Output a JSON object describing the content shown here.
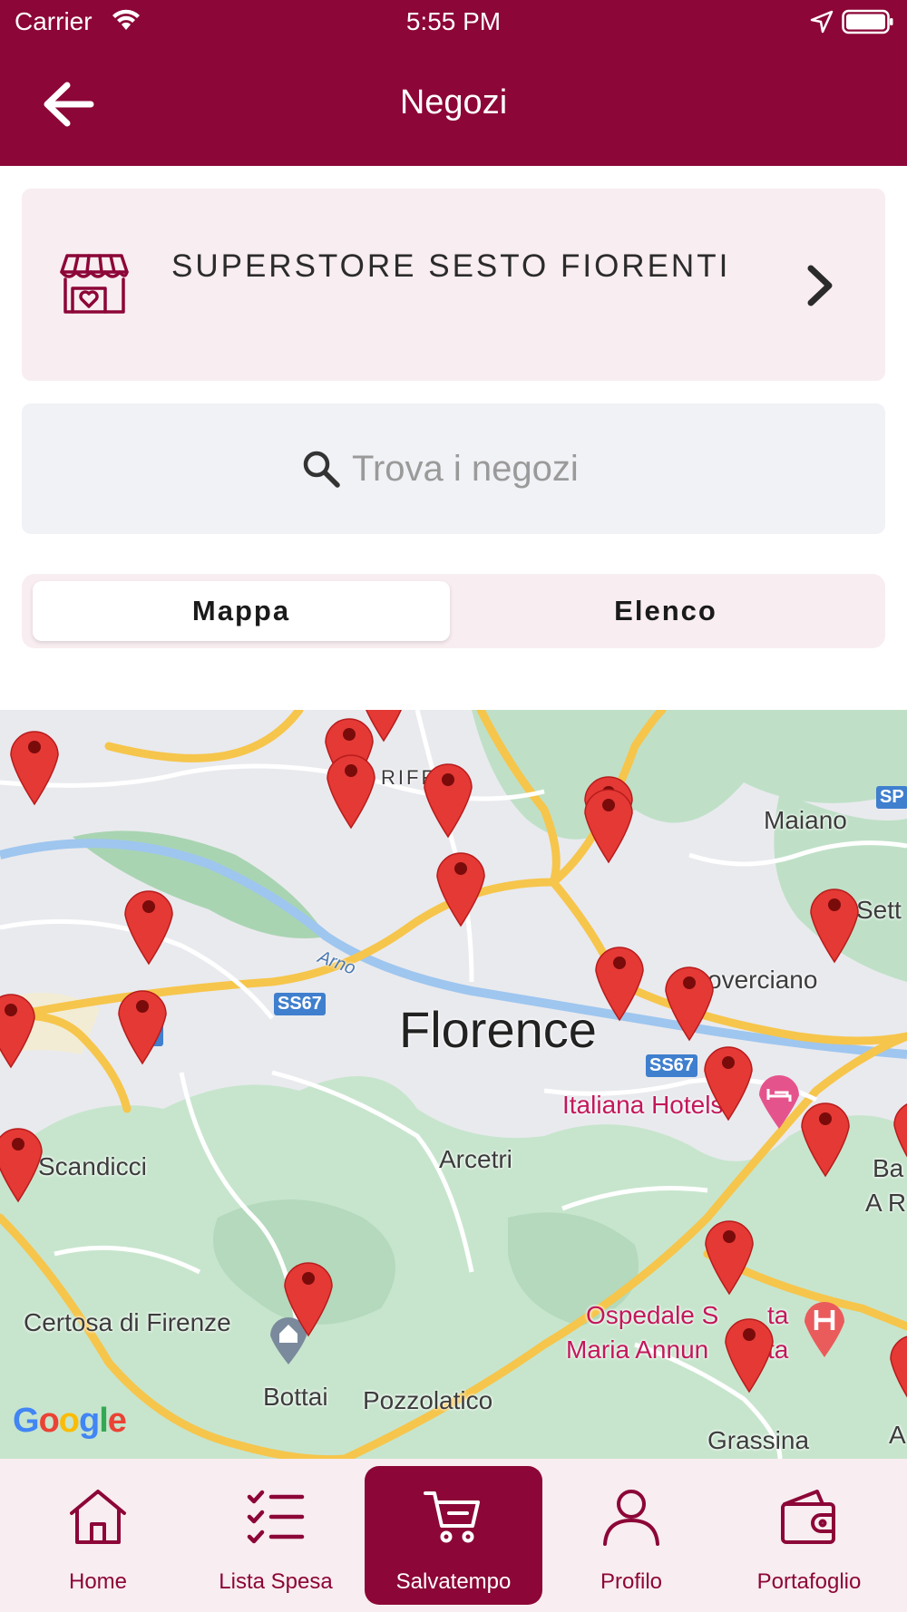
{
  "status_bar": {
    "carrier": "Carrier",
    "time": "5:55 PM"
  },
  "header": {
    "title": "Negozi"
  },
  "store": {
    "name": "SUPERSTORE SESTO FIORENTI"
  },
  "search": {
    "placeholder": "Trova i negozi",
    "value": ""
  },
  "view_toggle": {
    "selected": "Mappa",
    "options": [
      "Mappa",
      "Elenco"
    ]
  },
  "map": {
    "labels": {
      "florence": "Florence",
      "scandicci": "Scandicci",
      "arcetri": "Arcetri",
      "maiano": "Maiano",
      "coverciano": "overciano",
      "italiana_hotels": "Italiana Hotels",
      "certosa": "Certosa di Firenze",
      "bottai": "Bottai",
      "pozzolatico": "Pozzolatico",
      "grassina": "Grassina",
      "ospedale_1": "Ospedale S",
      "ospedale_1b": "ta",
      "ospedale_2": "Maria Annun",
      "ospedale_2b": "ta",
      "arno": "Arno",
      "riff": "RIFF",
      "sett": "Sett",
      "ba": "Ba",
      "ar": "A R",
      "a_edge": "A",
      "ss67_a": "SS67",
      "ss67_b": "67",
      "ss67_c": "SS67",
      "sp": "SP"
    },
    "google": "Google",
    "pin_color": "#e53935"
  },
  "tabs": [
    {
      "label": "Home",
      "icon": "home-icon"
    },
    {
      "label": "Lista Spesa",
      "icon": "checklist-icon"
    },
    {
      "label": "Salvatempo",
      "icon": "cart-icon",
      "active": true
    },
    {
      "label": "Profilo",
      "icon": "profile-icon"
    },
    {
      "label": "Portafoglio",
      "icon": "wallet-icon"
    }
  ],
  "colors": {
    "brand": "#8c0637",
    "card_bg": "#f8edf0"
  }
}
